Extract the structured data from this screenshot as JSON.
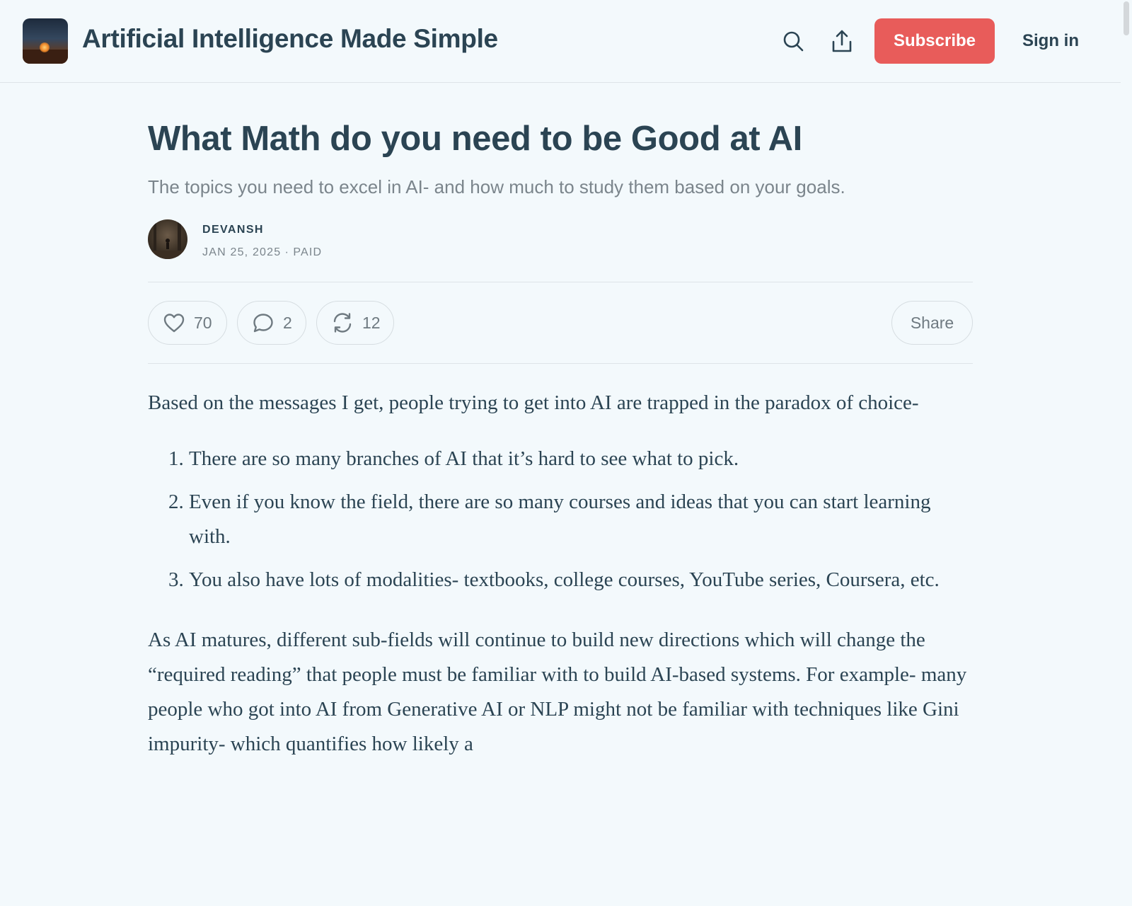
{
  "header": {
    "site_title": "Artificial Intelligence Made Simple",
    "subscribe_label": "Subscribe",
    "signin_label": "Sign in",
    "search_icon": "search-icon",
    "share_icon": "upload-share-icon"
  },
  "post": {
    "title": "What Math do you need to be Good at AI",
    "subtitle": "The topics you need to excel in AI- and how much to study them based on your goals.",
    "author": "DEVANSH",
    "date": "JAN 25, 2025",
    "access": "PAID",
    "meta_separator": "∙"
  },
  "actions": {
    "likes": "70",
    "comments": "2",
    "restacks": "12",
    "share_label": "Share"
  },
  "body": {
    "intro": "Based on the messages I get, people trying to get into AI are trapped in the paradox of choice-",
    "list": [
      "There are so many branches of AI that it’s hard to see what to pick.",
      "Even if you know the field, there are so many courses and ideas that you can start learning with.",
      "You also have lots of modalities- textbooks, college courses, YouTube series, Coursera, etc."
    ],
    "paragraph2": "As AI matures, different sub-fields will continue to build new directions which will change the “required reading” that people must be familiar with to build AI-based systems. For example- many people who got into AI from Generative AI or NLP might not be familiar with techniques like Gini impurity- which quantifies how likely a"
  },
  "colors": {
    "background": "#f3f9fc",
    "accent": "#e85c5a",
    "text": "#2b4453",
    "muted": "#7b858c"
  }
}
